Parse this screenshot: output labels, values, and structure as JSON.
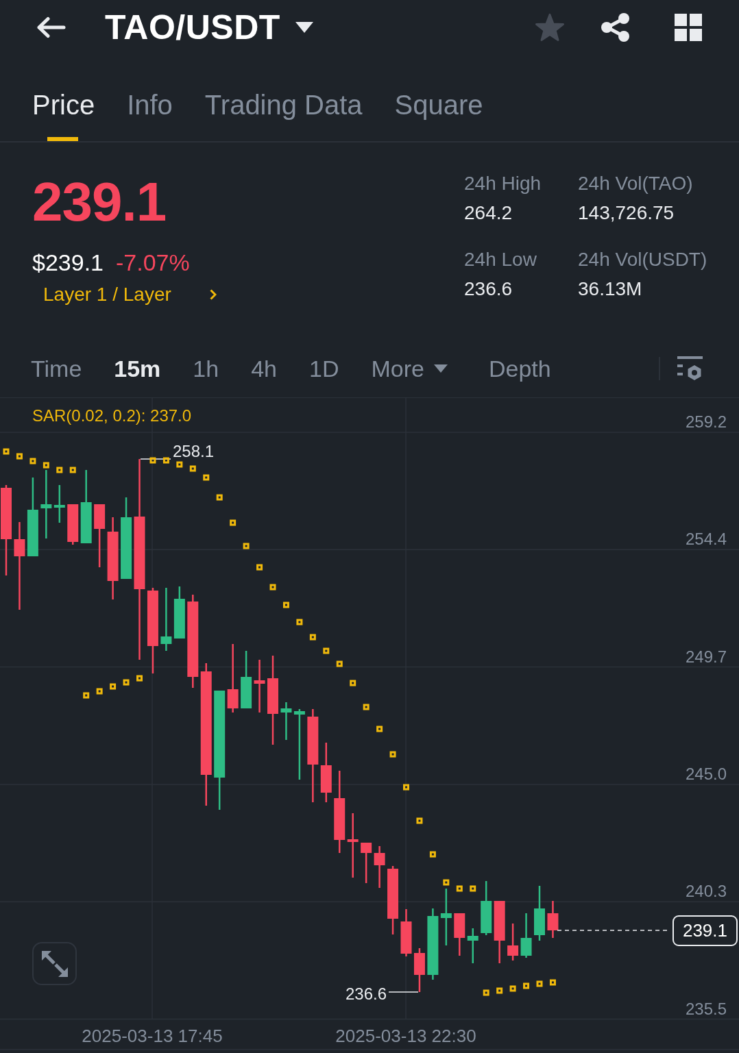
{
  "header": {
    "title": "TAO/USDT",
    "favorite": false
  },
  "tabs": [
    {
      "label": "Price",
      "selected": true
    },
    {
      "label": "Info",
      "selected": false
    },
    {
      "label": "Trading Data",
      "selected": false
    },
    {
      "label": "Square",
      "selected": false
    }
  ],
  "price": {
    "last": "239.1",
    "usd": "$239.1",
    "change": "-7.07%",
    "rising": false,
    "category": "Layer 1 / Layer"
  },
  "stats": [
    {
      "label": "24h High",
      "value": "264.2"
    },
    {
      "label": "24h Vol(TAO)",
      "value": "143,726.75"
    },
    {
      "label": "24h Low",
      "value": "236.6"
    },
    {
      "label": "24h Vol(USDT)",
      "value": "36.13M"
    }
  ],
  "intervals": [
    {
      "label": "Time",
      "kind": "interval",
      "selected": false
    },
    {
      "label": "15m",
      "kind": "interval",
      "selected": true
    },
    {
      "label": "1h",
      "kind": "interval",
      "selected": false
    },
    {
      "label": "4h",
      "kind": "interval",
      "selected": false
    },
    {
      "label": "1D",
      "kind": "interval",
      "selected": false
    },
    {
      "label": "More",
      "kind": "menu",
      "selected": false
    },
    {
      "label": "Depth",
      "kind": "view",
      "selected": false
    }
  ],
  "chart": {
    "indicator": "SAR(0.02, 0.2): 237.0",
    "y_axis": [
      "259.2",
      "254.4",
      "249.7",
      "245.0",
      "240.3",
      "235.5"
    ],
    "x_axis": [
      "2025-03-13 17:45",
      "2025-03-13 22:30"
    ],
    "high_marker": "258.1",
    "low_marker": "236.6",
    "last_price": "239.1"
  }
}
